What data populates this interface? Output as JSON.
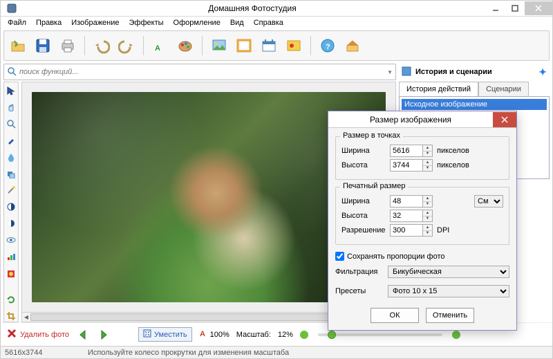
{
  "titlebar": {
    "app_title": "Домашняя Фотостудия"
  },
  "menus": {
    "file": "Файл",
    "edit": "Правка",
    "image": "Изображение",
    "effects": "Эффекты",
    "decor": "Оформление",
    "view": "Вид",
    "help": "Справка"
  },
  "search": {
    "placeholder": "поиск функций..."
  },
  "history": {
    "panel_title": "История и сценарии",
    "tab_history": "История действий",
    "tab_scenarios": "Сценарии",
    "item0": "Исходное изображение"
  },
  "bottom": {
    "delete_label": "Удалить фото",
    "fit_label": "Уместить",
    "zoom100_label": "100%",
    "scale_label": "Масштаб:",
    "scale_value": "12%"
  },
  "status": {
    "dimensions": "5616x3744",
    "hint": "Используйте колесо прокрутки для изменения масштаба"
  },
  "dialog": {
    "title": "Размер изображения",
    "pixel_group": "Размер в точках",
    "print_group": "Печатный размер",
    "width_label": "Ширина",
    "height_label": "Высота",
    "resolution_label": "Разрешение",
    "px_unit": "пикселов",
    "dpi_unit": "DPI",
    "cm_unit": "См",
    "width_px": "5616",
    "height_px": "3744",
    "width_print": "48",
    "height_print": "32",
    "resolution": "300",
    "keep_ratio_label": "Сохранять пропорции фото",
    "filter_label": "Фильтрация",
    "filter_value": "Бикубическая",
    "preset_label": "Пресеты",
    "preset_value": "Фото 10 х 15",
    "ok": "ОК",
    "cancel": "Отменить"
  }
}
